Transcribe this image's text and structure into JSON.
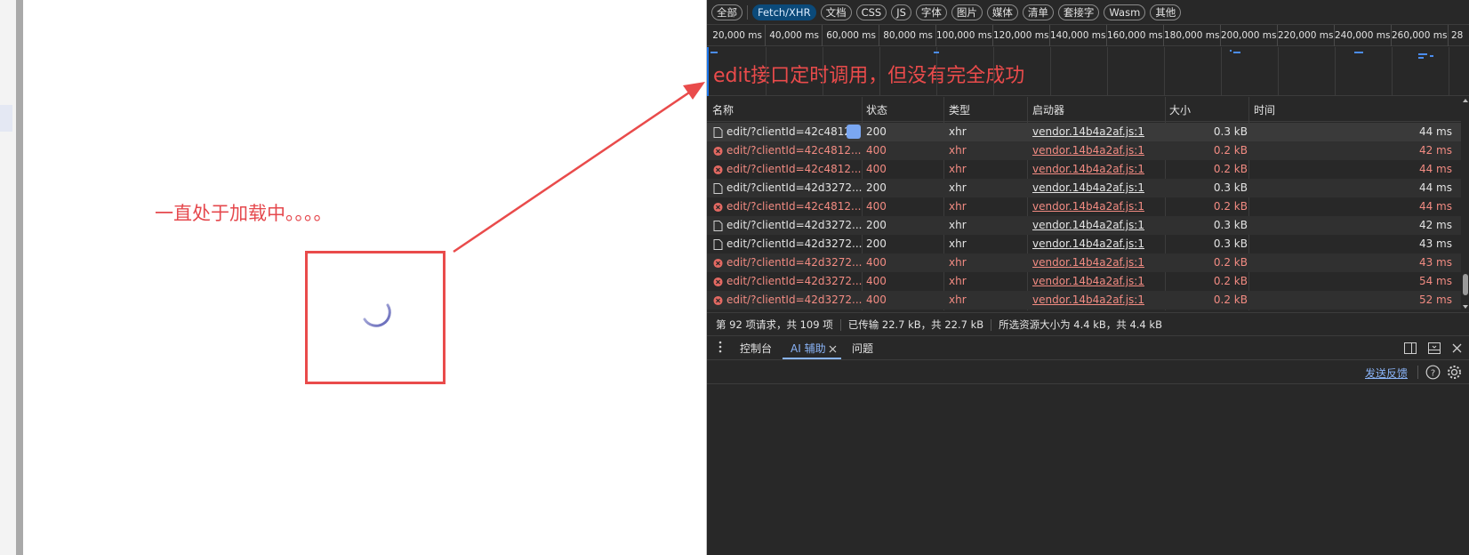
{
  "page": {
    "annotation_loading": "一直处于加载中。。。。"
  },
  "devtools": {
    "filters": [
      "全部",
      "Fetch/XHR",
      "文档",
      "CSS",
      "JS",
      "字体",
      "图片",
      "媒体",
      "清单",
      "套接字",
      "Wasm",
      "其他"
    ],
    "active_filter": "Fetch/XHR",
    "timeline_ticks": [
      "20,000 ms",
      "40,000 ms",
      "60,000 ms",
      "80,000 ms",
      "100,000 ms",
      "120,000 ms",
      "140,000 ms",
      "160,000 ms",
      "180,000 ms",
      "200,000 ms",
      "220,000 ms",
      "240,000 ms",
      "260,000 ms",
      "28"
    ],
    "annotation_edit": "edit接口定时调用，但没有完全成功",
    "columns": {
      "name": "名称",
      "status": "状态",
      "type": "类型",
      "initiator": "启动器",
      "size": "大小",
      "time": "时间"
    },
    "requests": [
      {
        "name": "edit/?clientId=42c4812",
        "status": "200",
        "type": "xhr",
        "initiator": "vendor.14b4a2af.js:1",
        "size": "0.3 kB",
        "time": "44 ms",
        "error": false
      },
      {
        "name": "edit/?clientId=42c4812...",
        "status": "400",
        "type": "xhr",
        "initiator": "vendor.14b4a2af.js:1",
        "size": "0.2 kB",
        "time": "42 ms",
        "error": true
      },
      {
        "name": "edit/?clientId=42c4812...",
        "status": "400",
        "type": "xhr",
        "initiator": "vendor.14b4a2af.js:1",
        "size": "0.2 kB",
        "time": "44 ms",
        "error": true
      },
      {
        "name": "edit/?clientId=42d3272...",
        "status": "200",
        "type": "xhr",
        "initiator": "vendor.14b4a2af.js:1",
        "size": "0.3 kB",
        "time": "44 ms",
        "error": false
      },
      {
        "name": "edit/?clientId=42c4812...",
        "status": "400",
        "type": "xhr",
        "initiator": "vendor.14b4a2af.js:1",
        "size": "0.2 kB",
        "time": "44 ms",
        "error": true
      },
      {
        "name": "edit/?clientId=42d3272...",
        "status": "200",
        "type": "xhr",
        "initiator": "vendor.14b4a2af.js:1",
        "size": "0.3 kB",
        "time": "42 ms",
        "error": false
      },
      {
        "name": "edit/?clientId=42d3272...",
        "status": "200",
        "type": "xhr",
        "initiator": "vendor.14b4a2af.js:1",
        "size": "0.3 kB",
        "time": "43 ms",
        "error": false
      },
      {
        "name": "edit/?clientId=42d3272...",
        "status": "400",
        "type": "xhr",
        "initiator": "vendor.14b4a2af.js:1",
        "size": "0.2 kB",
        "time": "43 ms",
        "error": true
      },
      {
        "name": "edit/?clientId=42d3272...",
        "status": "400",
        "type": "xhr",
        "initiator": "vendor.14b4a2af.js:1",
        "size": "0.2 kB",
        "time": "54 ms",
        "error": true
      },
      {
        "name": "edit/?clientId=42d3272...",
        "status": "400",
        "type": "xhr",
        "initiator": "vendor.14b4a2af.js:1",
        "size": "0.2 kB",
        "time": "52 ms",
        "error": true
      }
    ],
    "summary": {
      "requests": "第 92 项请求，共 109 项",
      "transferred": "已传输 22.7 kB，共 22.7 kB",
      "resources": "所选资源大小为 4.4 kB，共 4.4 kB"
    },
    "drawer": {
      "tabs": [
        "控制台",
        "AI 辅助",
        "问题"
      ],
      "active_tab": "AI 辅助",
      "feedback": "发送反馈"
    },
    "colors": {
      "background": "#282828",
      "error_text": "#f28b82",
      "accent": "#8ab4f8",
      "annotation_red": "#e94b4b"
    }
  }
}
